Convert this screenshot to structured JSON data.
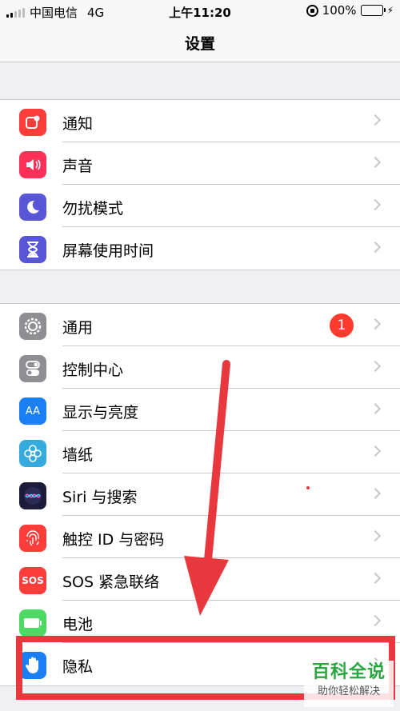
{
  "status_bar": {
    "carrier": "中国电信",
    "network": "4G",
    "time": "上午11:20",
    "battery": "100%"
  },
  "nav": {
    "title": "设置"
  },
  "groups": [
    {
      "items": [
        {
          "label": "通知",
          "icon": "notifications-icon",
          "color": "#fc3d39"
        },
        {
          "label": "声音",
          "icon": "sounds-icon",
          "color": "#fd3158"
        },
        {
          "label": "勿扰模式",
          "icon": "moon-icon",
          "color": "#5856d6"
        },
        {
          "label": "屏幕使用时间",
          "icon": "hourglass-icon",
          "color": "#5856d6"
        }
      ]
    },
    {
      "items": [
        {
          "label": "通用",
          "icon": "gear-icon",
          "color": "#8e8e93",
          "badge": "1"
        },
        {
          "label": "控制中心",
          "icon": "toggle-switches-icon",
          "color": "#8e8e93"
        },
        {
          "label": "显示与亮度",
          "icon": "aa-text-icon",
          "icon_text": "AA",
          "color": "#1a7ef5"
        },
        {
          "label": "墙纸",
          "icon": "flower-icon",
          "color": "#35aadc"
        },
        {
          "label": "Siri 与搜索",
          "icon": "siri-icon",
          "color": "#1c1c3a"
        },
        {
          "label": "触控 ID 与密码",
          "icon": "fingerprint-icon",
          "color": "#fc3d39"
        },
        {
          "label": "SOS 紧急联络",
          "icon": "sos-icon",
          "icon_text": "SOS",
          "color": "#fc3d39"
        },
        {
          "label": "电池",
          "icon": "battery-icon",
          "color": "#4cd964"
        },
        {
          "label": "隐私",
          "icon": "hand-icon",
          "color": "#1a7ef5"
        }
      ]
    }
  ],
  "watermark": {
    "main": "百科全说",
    "sub": "助你轻松解决"
  },
  "colors": {
    "annotation_red": "#e8383d",
    "watermark_green": "#2aa640"
  }
}
